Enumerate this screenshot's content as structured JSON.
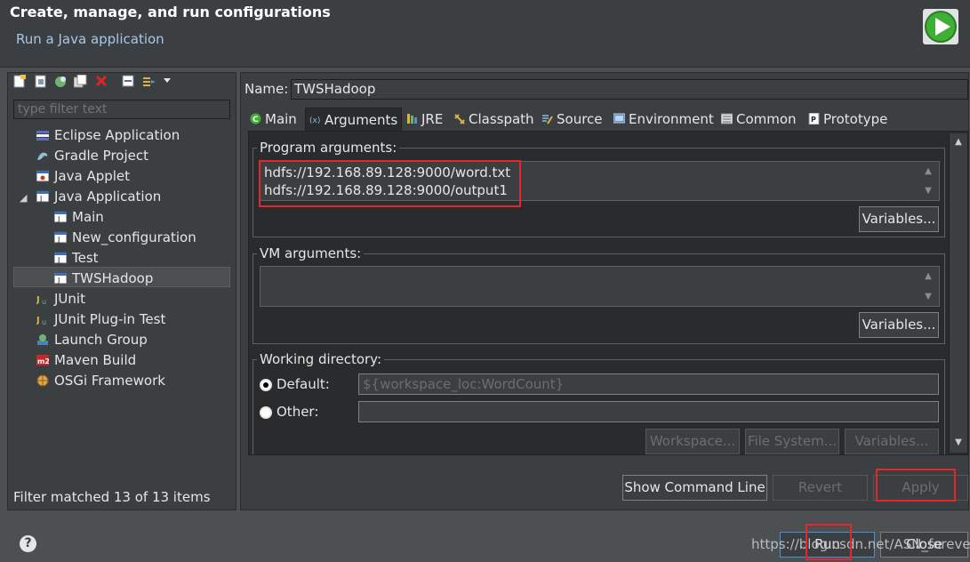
{
  "header": {
    "title": "Create, manage, and run configurations",
    "subtitle": "Run a Java application"
  },
  "left": {
    "filter_placeholder": "type filter text",
    "items": [
      {
        "label": "Eclipse Application",
        "icon": "eclipse-icon"
      },
      {
        "label": "Gradle Project",
        "icon": "gradle-icon"
      },
      {
        "label": "Java Applet",
        "icon": "applet-icon"
      },
      {
        "label": "Java Application",
        "icon": "java-app-icon",
        "expanded": true
      },
      {
        "label": "Main",
        "icon": "java-config-icon"
      },
      {
        "label": "New_configuration",
        "icon": "java-config-icon"
      },
      {
        "label": "Test",
        "icon": "java-config-icon"
      },
      {
        "label": "TWSHadoop",
        "icon": "java-config-icon",
        "selected": true
      },
      {
        "label": "JUnit",
        "icon": "junit-icon"
      },
      {
        "label": "JUnit Plug-in Test",
        "icon": "junit-plugin-icon"
      },
      {
        "label": "Launch Group",
        "icon": "launch-group-icon"
      },
      {
        "label": "Maven Build",
        "icon": "maven-icon"
      },
      {
        "label": "OSGi Framework",
        "icon": "osgi-icon"
      }
    ],
    "status": "Filter matched 13 of 13 items"
  },
  "config": {
    "name_label": "Name:",
    "name_value": "TWSHadoop",
    "tabs": [
      {
        "label": "Main",
        "active": false
      },
      {
        "label": "Arguments",
        "active": true
      },
      {
        "label": "JRE",
        "active": false
      },
      {
        "label": "Classpath",
        "active": false
      },
      {
        "label": "Source",
        "active": false
      },
      {
        "label": "Environment",
        "active": false
      },
      {
        "label": "Common",
        "active": false
      },
      {
        "label": "Prototype",
        "active": false
      }
    ],
    "program_args_label": "Program arguments:",
    "program_args_value": "hdfs://192.168.89.128:9000/word.txt\nhdfs://192.168.89.128:9000/output1",
    "variables_label": "Variables...",
    "vm_args_label": "VM arguments:",
    "vm_args_value": "",
    "working_dir_label": "Working directory:",
    "default_label": "Default:",
    "default_value": "${workspace_loc:WordCount}",
    "other_label": "Other:",
    "other_value": "",
    "workspace_btn": "Workspace...",
    "filesystem_btn": "File System...",
    "variables_btn2": "Variables..."
  },
  "actions": {
    "show_cmd": "Show Command Line",
    "revert": "Revert",
    "apply": "Apply",
    "run": "Run",
    "close": "Close"
  },
  "footer": {
    "watermark": "https://blog.csdn.net/ASN_forever"
  },
  "colors": {
    "highlight": "#e5262b",
    "accent_link": "#a6c8e6"
  }
}
